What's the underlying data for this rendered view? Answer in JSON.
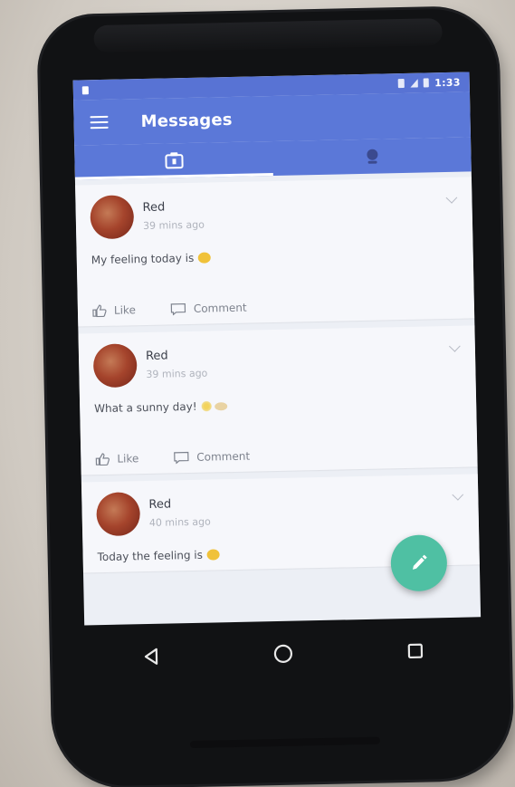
{
  "status_bar": {
    "time": "1:33"
  },
  "app_bar": {
    "title": "Messages"
  },
  "tabs": [
    {
      "icon": "camera-icon",
      "selected": true
    },
    {
      "icon": "user-icon",
      "selected": false
    }
  ],
  "posts": [
    {
      "author": "Red",
      "time_ago": "39 mins ago",
      "text": "My feeling today is",
      "emoji": "laughing-emoji"
    },
    {
      "author": "Red",
      "time_ago": "39 mins ago",
      "text": "What a sunny day!",
      "emoji": "sun-eyes-emoji"
    },
    {
      "author": "Red",
      "time_ago": "40 mins ago",
      "text": "Today the feeling is",
      "emoji": "smiling-emoji"
    }
  ],
  "actions": {
    "like_label": "Like",
    "comment_label": "Comment"
  },
  "colors": {
    "primary": "#5b78d8",
    "status_bar": "#5873d4",
    "fab": "#4fc0a3",
    "avatar": "#a5442c"
  }
}
